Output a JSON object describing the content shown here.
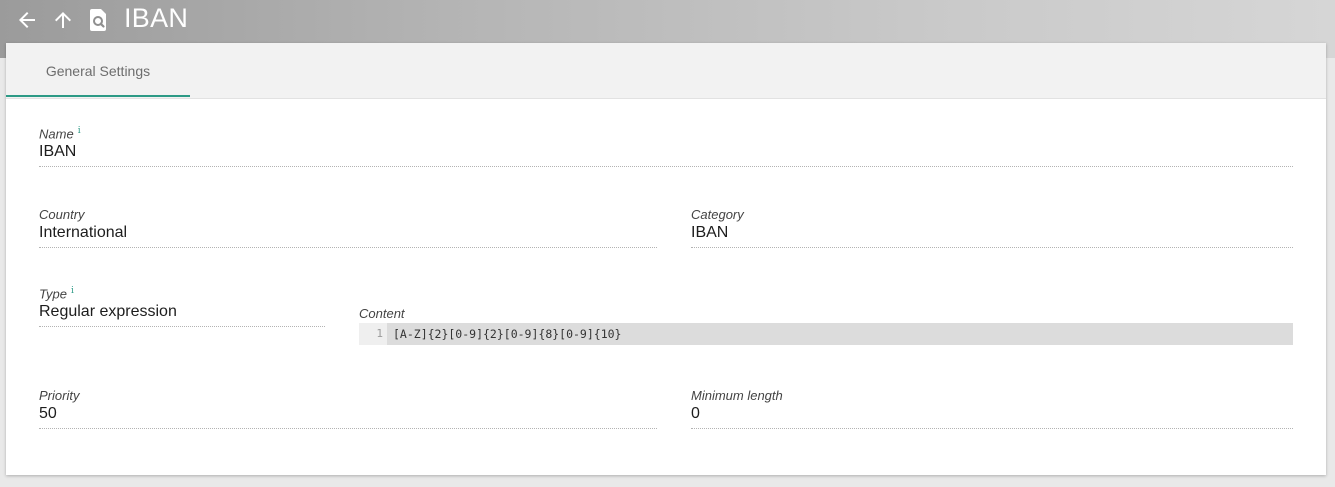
{
  "header": {
    "title": "IBAN",
    "back_icon": "arrow-left-icon",
    "up_icon": "arrow-up-icon",
    "app_icon": "document-search-icon"
  },
  "tabs": [
    {
      "label": "General Settings",
      "active": true
    }
  ],
  "form": {
    "name": {
      "label": "Name",
      "info": "i",
      "value": "IBAN"
    },
    "country": {
      "label": "Country",
      "value": "International"
    },
    "category": {
      "label": "Category",
      "value": "IBAN"
    },
    "type": {
      "label": "Type",
      "info": "i",
      "value": "Regular expression"
    },
    "content": {
      "label": "Content",
      "line_number": "1",
      "code": "[A-Z]{2}[0-9]{2}[0-9]{8}[0-9]{10}"
    },
    "priority": {
      "label": "Priority",
      "value": "50"
    },
    "minimum_length": {
      "label": "Minimum length",
      "value": "0"
    }
  },
  "colors": {
    "accent": "#2d9a86",
    "header_text": "#ffffff"
  }
}
